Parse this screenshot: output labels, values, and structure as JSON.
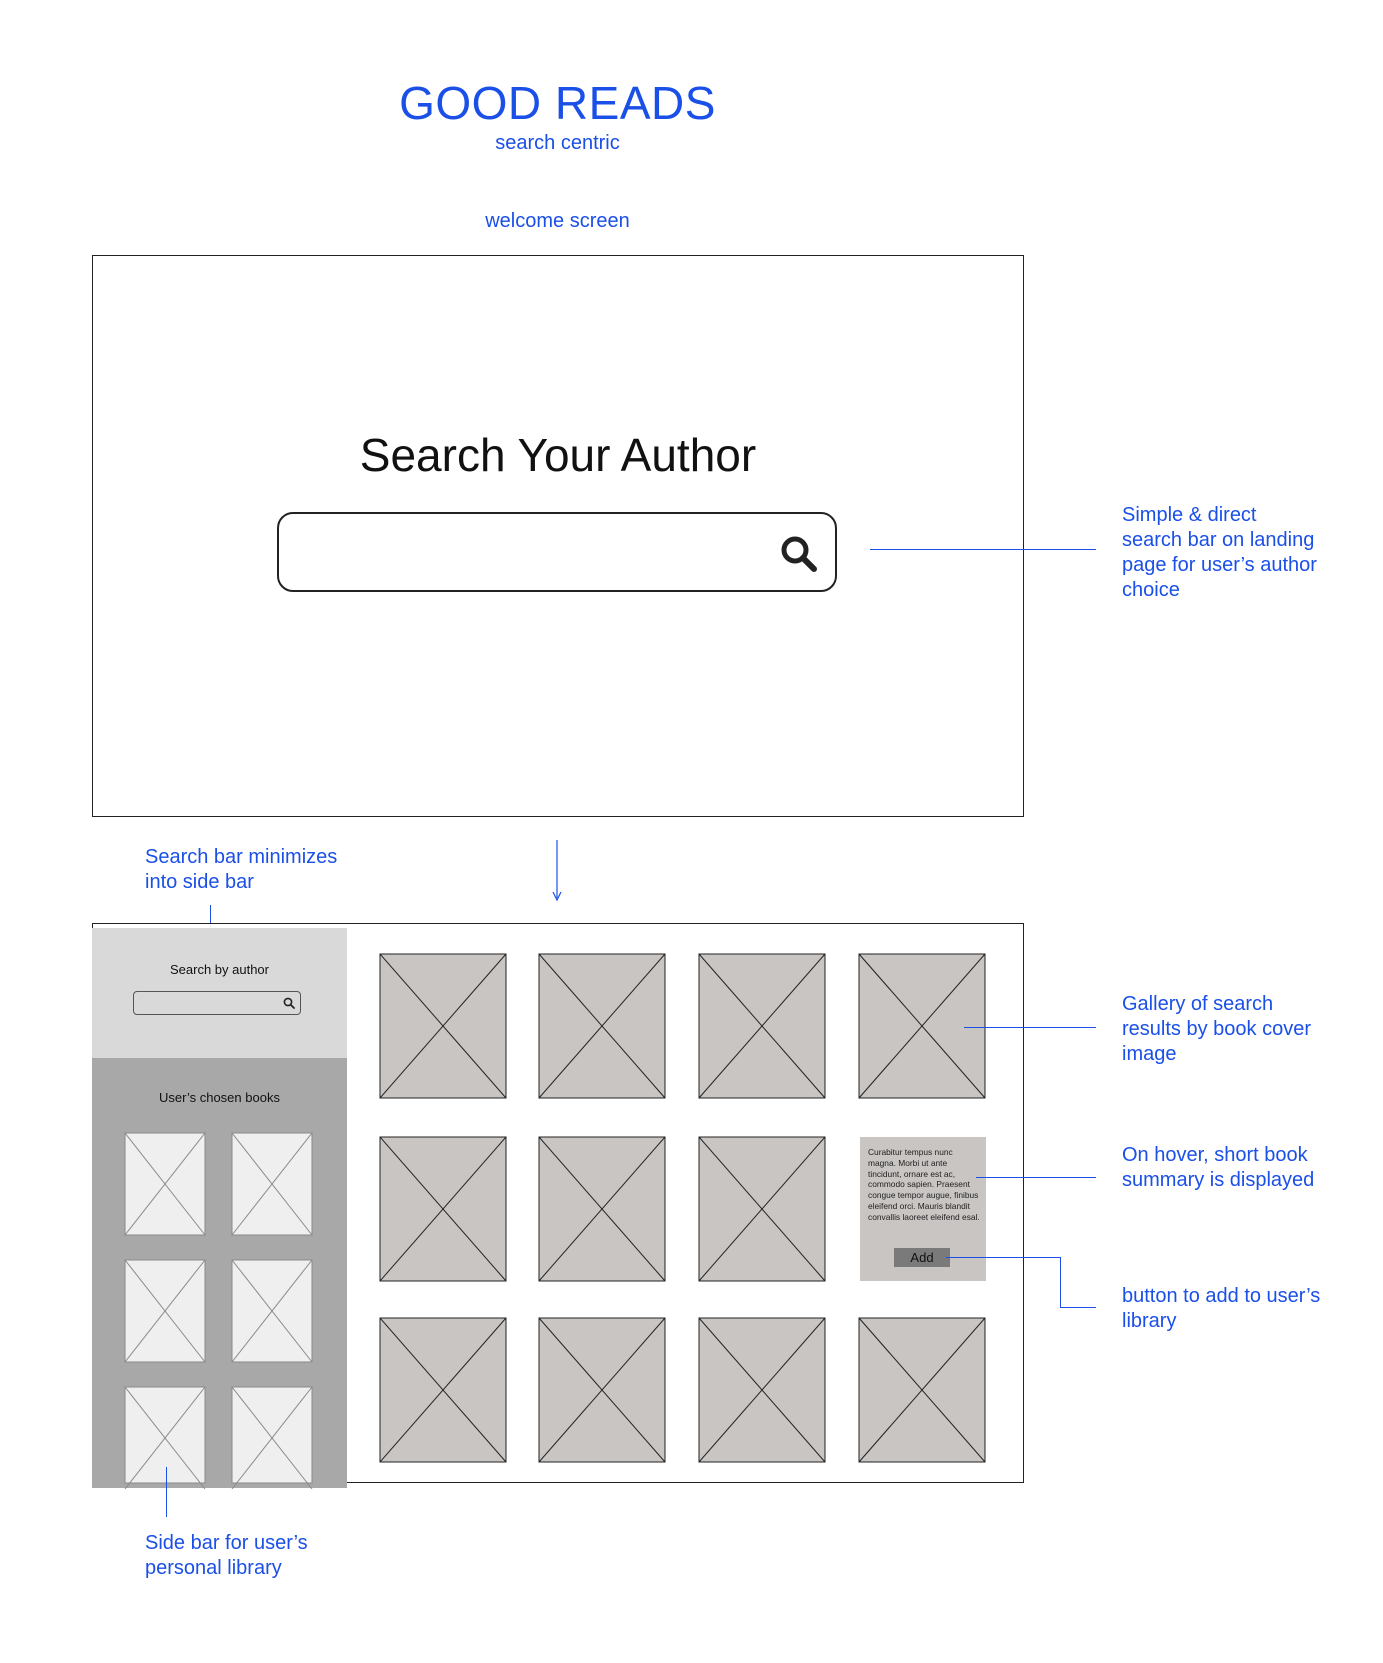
{
  "header": {
    "title": "GOOD READS",
    "subtitle": "search centric",
    "screen_label": "welcome screen"
  },
  "welcome": {
    "heading": "Search Your Author",
    "search_placeholder": "",
    "search_icon": "search-icon"
  },
  "results": {
    "sidebar": {
      "search_label": "Search by author",
      "library_label": "User’s chosen books"
    },
    "hover_card": {
      "summary": "Curabitur tempus nunc magna. Morbi ut ante tincidunt, ornare est ac, commodo sapien. Praesent congue tempor augue, finibus eleifend orci. Mauris blandit convallis laoreet eleifend esal.",
      "add_label": "Add"
    }
  },
  "notes": {
    "search_bar": "Simple & direct search bar on landing page for user’s author choice",
    "minimize": "Search bar minimizes into side bar",
    "gallery": "Gallery of search results by book cover image",
    "hover": "On hover, short book summary is displayed",
    "add_button": "button to add to user’s library",
    "sidebar": "Side bar for user’s personal library"
  },
  "colors": {
    "accent": "#1a4fe8",
    "placeholder_fill": "#c8c5c3",
    "sidebar_light": "#d9d9d9",
    "sidebar_dark": "#a8a8a8",
    "library_thumb": "#efefef"
  }
}
